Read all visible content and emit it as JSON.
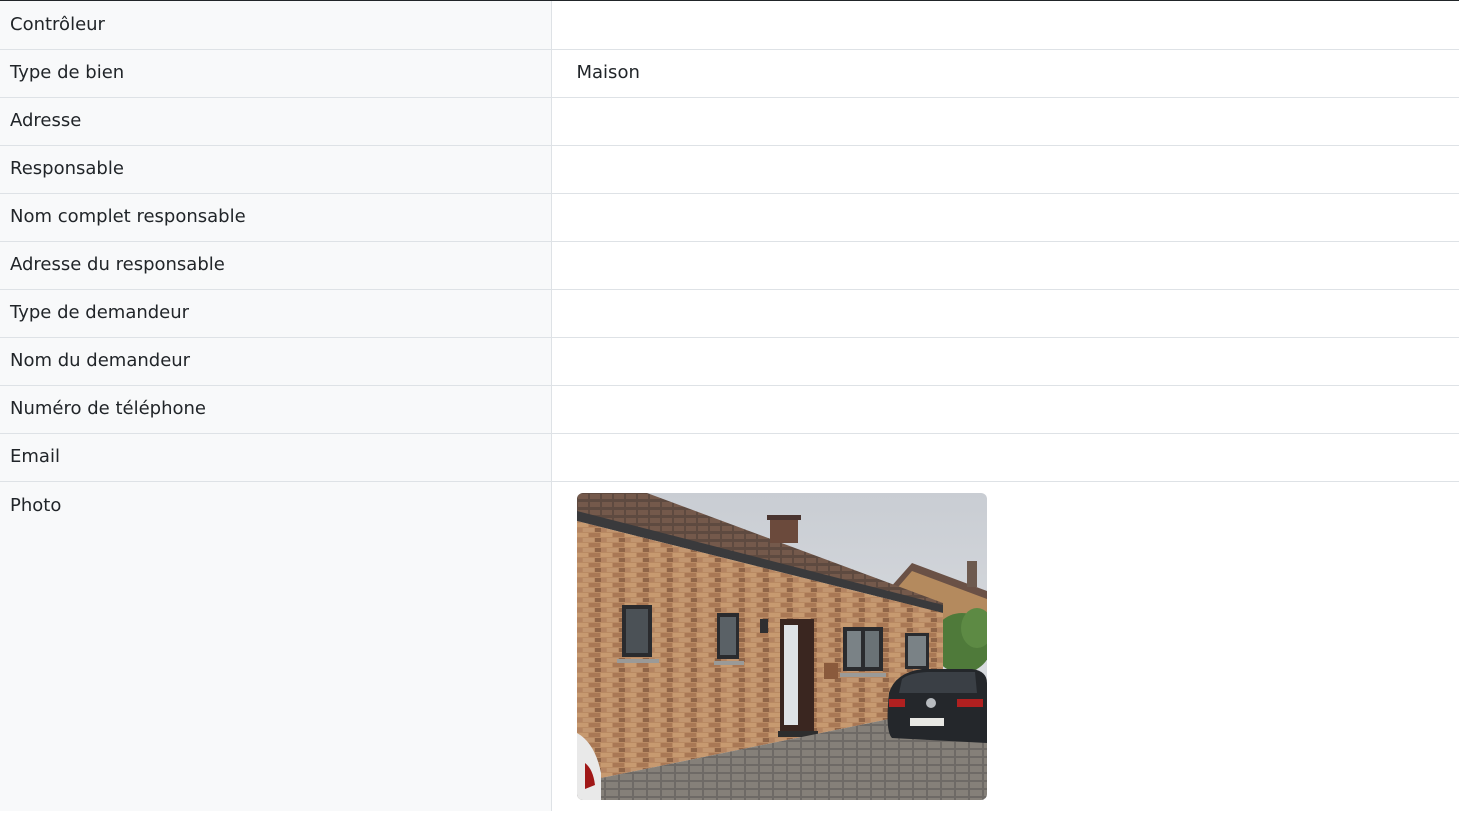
{
  "rows": [
    {
      "label": "Contrôleur",
      "value": ""
    },
    {
      "label": "Type de bien",
      "value": "Maison"
    },
    {
      "label": "Adresse",
      "value": ""
    },
    {
      "label": "Responsable",
      "value": ""
    },
    {
      "label": "Nom complet responsable",
      "value": ""
    },
    {
      "label": "Adresse du responsable",
      "value": ""
    },
    {
      "label": "Type de demandeur",
      "value": ""
    },
    {
      "label": "Nom du demandeur",
      "value": ""
    },
    {
      "label": "Numéro de téléphone",
      "value": ""
    },
    {
      "label": "Email",
      "value": ""
    }
  ],
  "photo": {
    "label": "Photo",
    "image_description": "brick-house-photo"
  }
}
